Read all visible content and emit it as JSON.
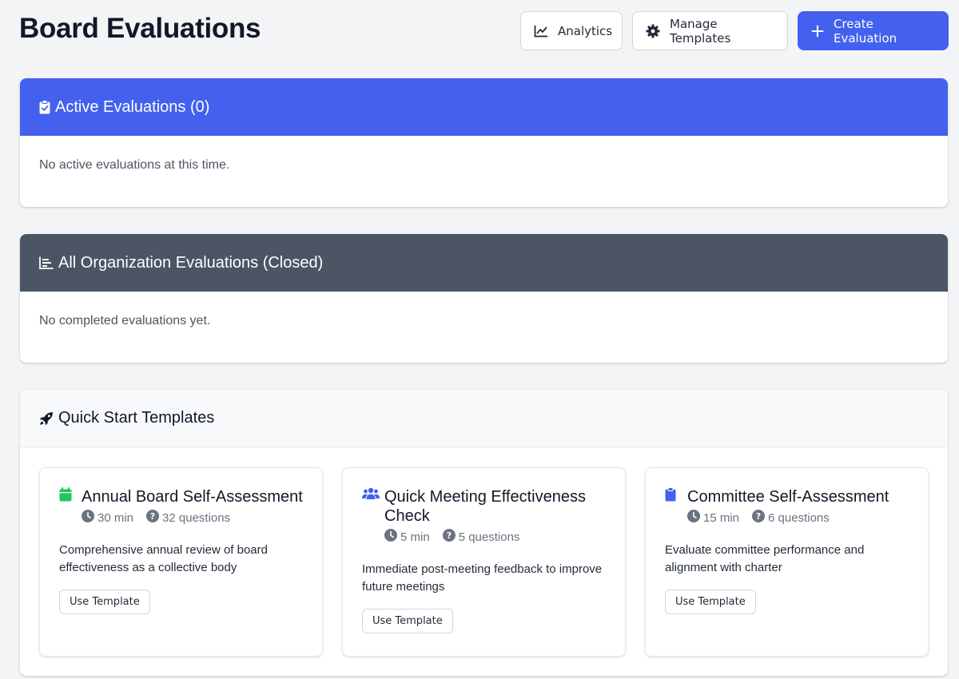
{
  "page": {
    "title": "Board Evaluations"
  },
  "actions": {
    "analytics_label": "Analytics",
    "manage_templates_label": "Manage Templates",
    "create_evaluation_label": "Create Evaluation"
  },
  "colors": {
    "primary": "#4361ee",
    "closed_header": "#4b5563",
    "background": "#f3f4f6"
  },
  "active_evaluations": {
    "title": "Active Evaluations (0)",
    "empty_message": "No active evaluations at this time.",
    "icon": "clipboard-check-icon"
  },
  "closed_evaluations": {
    "title": "All Organization Evaluations (Closed)",
    "empty_message": "No completed evaluations yet.",
    "icon": "chart-bar-icon"
  },
  "quick_start": {
    "title": "Quick Start Templates",
    "icon": "rocket-icon",
    "templates": [
      {
        "title": "Annual Board Self-Assessment",
        "icon": "calendar-icon",
        "icon_color": "#22c55e",
        "duration": "30 min",
        "questions": "32 questions",
        "description": "Comprehensive annual review of board effectiveness as a collective body",
        "button_label": "Use Template"
      },
      {
        "title": "Quick Meeting Effectiveness Check",
        "icon": "users-icon",
        "icon_color": "#4361ee",
        "duration": "5 min",
        "questions": "5 questions",
        "description": "Immediate post-meeting feedback to improve future meetings",
        "button_label": "Use Template"
      },
      {
        "title": "Committee Self-Assessment",
        "icon": "clipboard-icon",
        "icon_color": "#4361ee",
        "duration": "15 min",
        "questions": "6 questions",
        "description": "Evaluate committee performance and alignment with charter",
        "button_label": "Use Template"
      }
    ]
  }
}
